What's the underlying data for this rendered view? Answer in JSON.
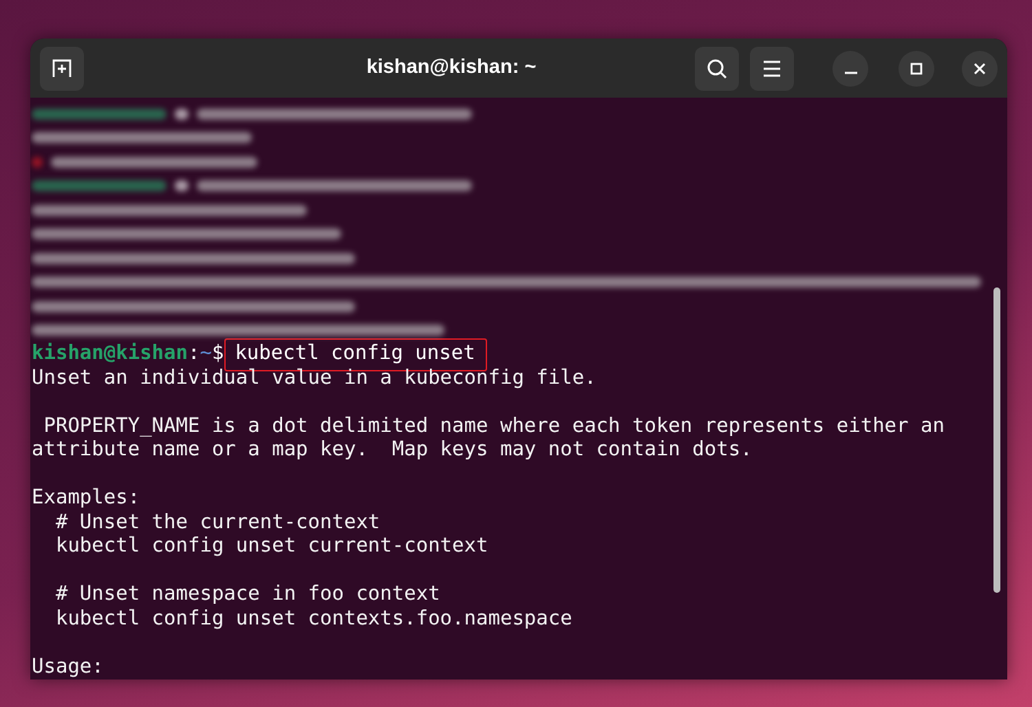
{
  "window": {
    "title": "kishan@kishan: ~"
  },
  "terminal": {
    "lines": [
      {
        "kind": "prompt",
        "user": "kishan@kishan",
        "separator": ":",
        "path": "~",
        "symbol": "$",
        "command": "kubectl config unset",
        "highlighted": true
      },
      {
        "kind": "output",
        "text": "Unset an individual value in a kubeconfig file."
      },
      {
        "kind": "blank"
      },
      {
        "kind": "output",
        "text": " PROPERTY_NAME is a dot delimited name where each token represents either an"
      },
      {
        "kind": "output",
        "text": "attribute name or a map key.  Map keys may not contain dots."
      },
      {
        "kind": "blank"
      },
      {
        "kind": "output",
        "text": "Examples:"
      },
      {
        "kind": "output",
        "text": "  # Unset the current-context"
      },
      {
        "kind": "output",
        "text": "  kubectl config unset current-context"
      },
      {
        "kind": "blank"
      },
      {
        "kind": "output",
        "text": "  # Unset namespace in foo context"
      },
      {
        "kind": "output",
        "text": "  kubectl config unset contexts.foo.namespace"
      },
      {
        "kind": "blank"
      },
      {
        "kind": "output",
        "text": "Usage:"
      }
    ]
  }
}
